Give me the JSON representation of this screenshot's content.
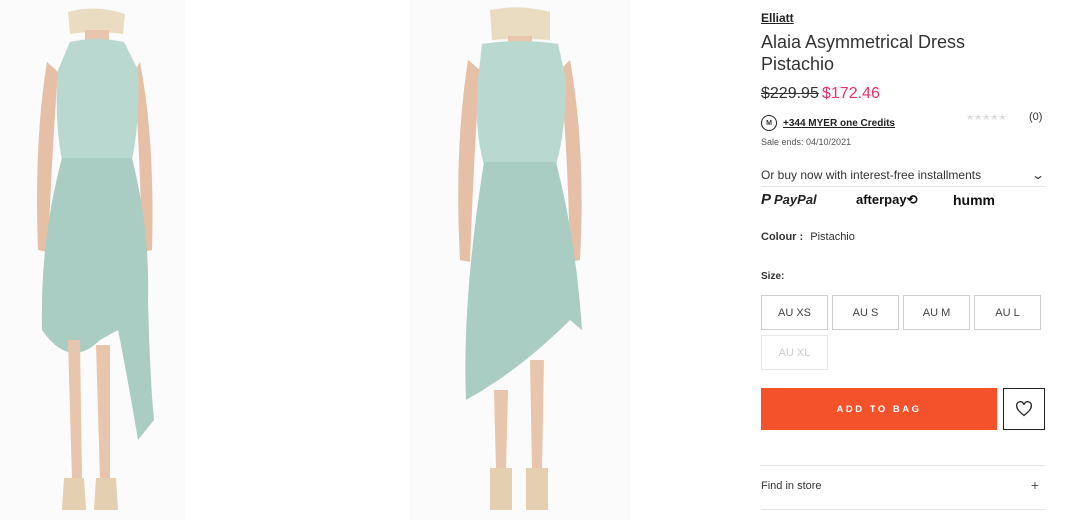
{
  "gallery": {
    "front_image": "dress-front-photo",
    "back_image": "dress-back-photo"
  },
  "product": {
    "brand": "Elliatt",
    "title": "Alaia Asymmetrical Dress Pistachio",
    "price_old": "$229.95",
    "price_new": "$172.46",
    "credits_badge": "M",
    "credits_text": "+344 MYER one Credits",
    "rating_stars": "★★★★★",
    "rating_value": 0,
    "review_count": "(0)",
    "sale_ends": "Sale ends: 04/10/2021"
  },
  "payment": {
    "installments_text": "Or buy now with interest-free installments",
    "chevron": "⌄",
    "providers": {
      "paypal_mark": "P",
      "paypal": "PayPal",
      "afterpay": "afterpay⟲",
      "humm": "humm"
    }
  },
  "colour": {
    "label": "Colour :",
    "value": "Pistachio"
  },
  "size": {
    "label": "Size:",
    "options": [
      {
        "label": "AU XS",
        "available": true
      },
      {
        "label": "AU S",
        "available": true
      },
      {
        "label": "AU M",
        "available": true
      },
      {
        "label": "AU L",
        "available": true
      },
      {
        "label": "AU XL",
        "available": false
      }
    ]
  },
  "actions": {
    "add_to_bag": "ADD TO BAG",
    "wishlist_icon": "heart-icon"
  },
  "find_in_store": {
    "label": "Find in store",
    "toggle": "+"
  },
  "colors": {
    "accent": "#f4522a",
    "sale_price": "#e8336a",
    "dress": "#b9d8cf"
  }
}
